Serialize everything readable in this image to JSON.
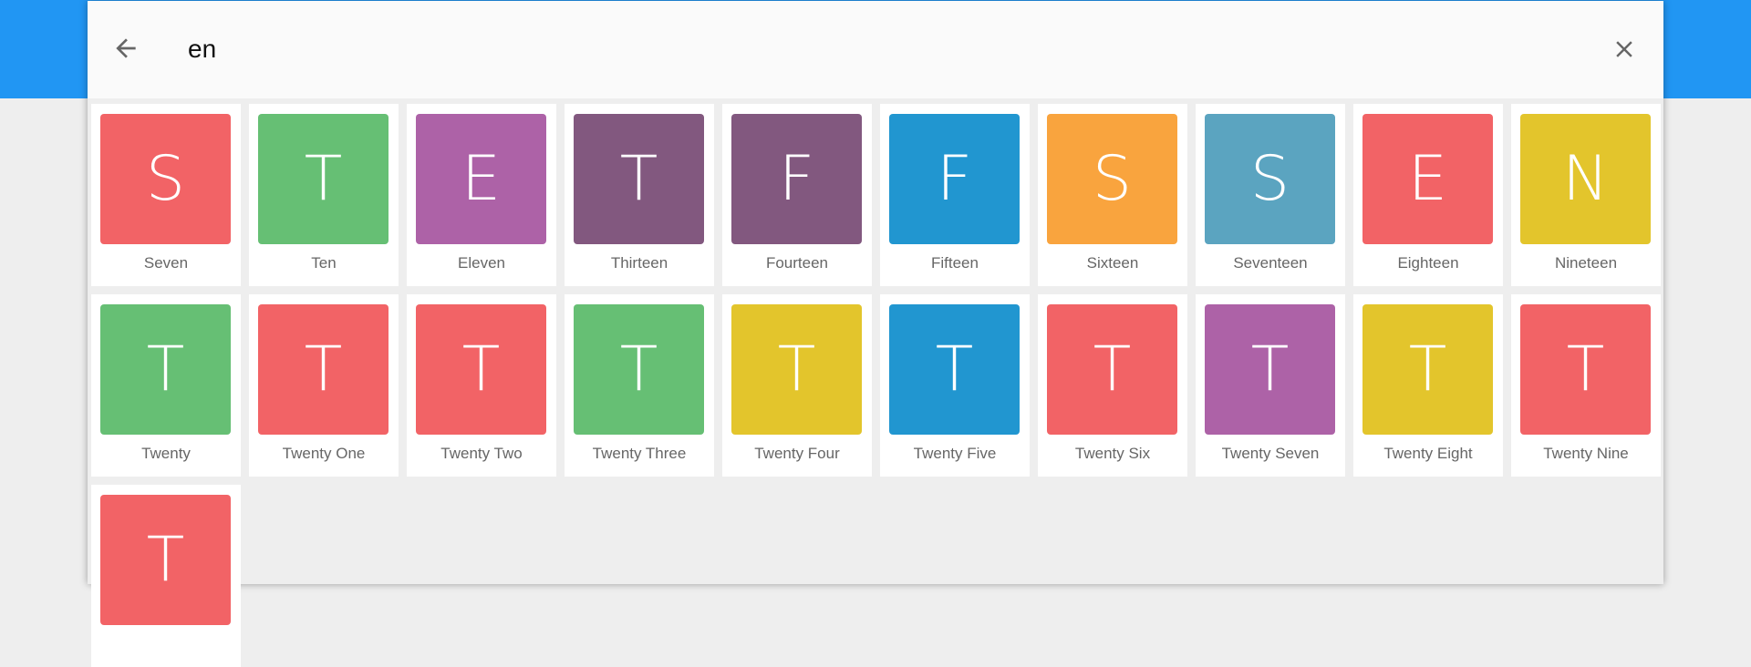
{
  "search": {
    "query": "en",
    "back_icon": "arrow-left-icon",
    "clear_icon": "close-icon"
  },
  "colors": {
    "appbar": "#2196F3"
  },
  "results": [
    {
      "letter": "S",
      "label": "Seven",
      "color": "#F26366"
    },
    {
      "letter": "T",
      "label": "Ten",
      "color": "#66BF74"
    },
    {
      "letter": "E",
      "label": "Eleven",
      "color": "#AD62A7"
    },
    {
      "letter": "T",
      "label": "Thirteen",
      "color": "#82587F"
    },
    {
      "letter": "F",
      "label": "Fourteen",
      "color": "#82587F"
    },
    {
      "letter": "F",
      "label": "Fifteen",
      "color": "#2196D0"
    },
    {
      "letter": "S",
      "label": "Sixteen",
      "color": "#F9A43E"
    },
    {
      "letter": "S",
      "label": "Seventeen",
      "color": "#5BA4C0"
    },
    {
      "letter": "E",
      "label": "Eighteen",
      "color": "#F26366"
    },
    {
      "letter": "N",
      "label": "Nineteen",
      "color": "#E3C52C"
    },
    {
      "letter": "T",
      "label": "Twenty",
      "color": "#66BF74"
    },
    {
      "letter": "T",
      "label": "Twenty One",
      "color": "#F26366"
    },
    {
      "letter": "T",
      "label": "Twenty Two",
      "color": "#F26366"
    },
    {
      "letter": "T",
      "label": "Twenty Three",
      "color": "#66BF74"
    },
    {
      "letter": "T",
      "label": "Twenty Four",
      "color": "#E3C52C"
    },
    {
      "letter": "T",
      "label": "Twenty Five",
      "color": "#2196D0"
    },
    {
      "letter": "T",
      "label": "Twenty Six",
      "color": "#F26366"
    },
    {
      "letter": "T",
      "label": "Twenty Seven",
      "color": "#AD62A7"
    },
    {
      "letter": "T",
      "label": "Twenty Eight",
      "color": "#E3C52C"
    },
    {
      "letter": "T",
      "label": "Twenty Nine",
      "color": "#F26366"
    },
    {
      "letter": "T",
      "label": "",
      "color": "#F26366"
    }
  ]
}
